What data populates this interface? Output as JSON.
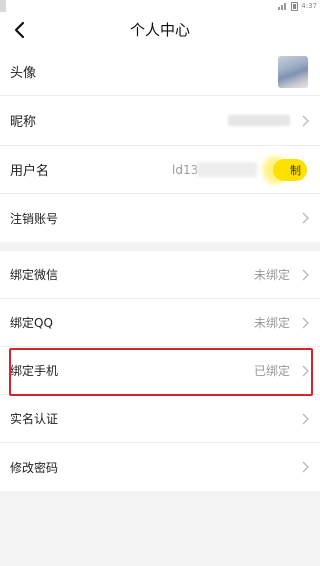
{
  "status_bar": {
    "time": "4:37",
    "battery_icon": "battery-icon",
    "signal_icon": "signal-icon"
  },
  "header": {
    "title": "个人中心",
    "back_icon": "chevron-left-icon"
  },
  "profile": {
    "avatar_label": "头像",
    "nickname_label": "昵称",
    "username_label": "用户名",
    "username_value": "ld13",
    "copy_button": "制",
    "cancel_account_label": "注销账号"
  },
  "bindings": {
    "wechat_label": "绑定微信",
    "wechat_status": "未绑定",
    "qq_label": "绑定QQ",
    "qq_status": "未绑定",
    "phone_label": "绑定手机",
    "phone_status": "已绑定",
    "realname_label": "实名认证",
    "password_label": "修改密码"
  },
  "colors": {
    "accent": "#ffe100",
    "highlight": "#d9232d",
    "background": "#f4f4f4"
  }
}
